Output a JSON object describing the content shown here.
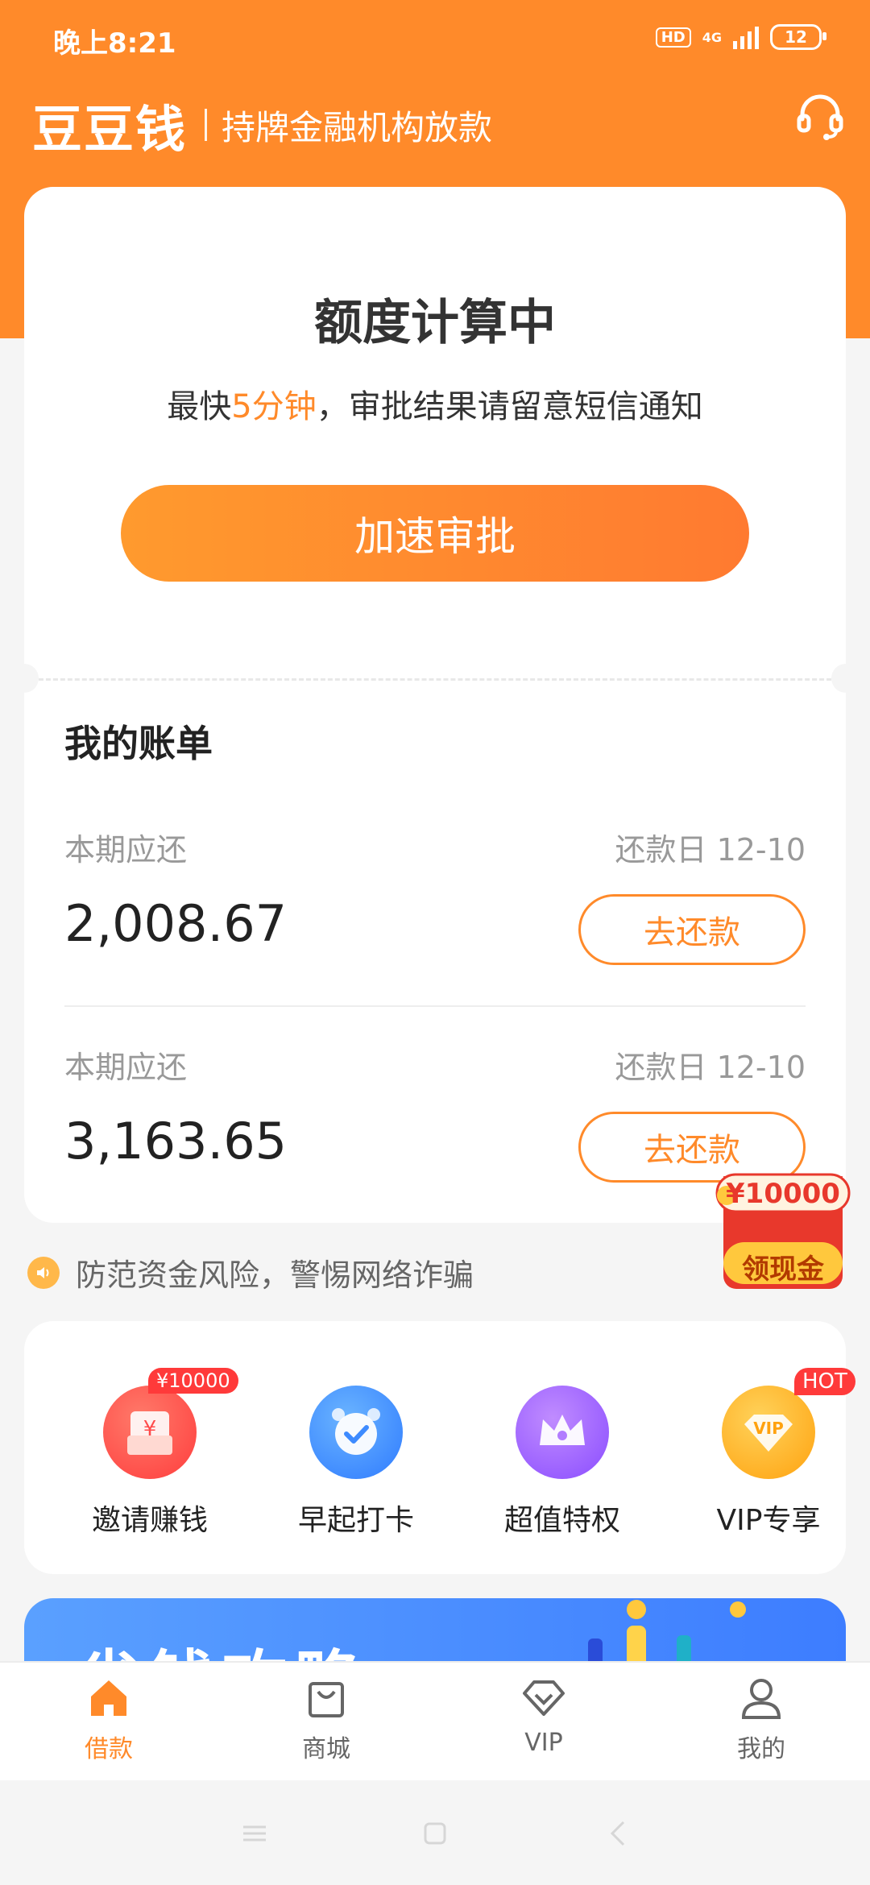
{
  "status": {
    "time": "晚上8:21",
    "hd": "HD",
    "network": "4G",
    "battery": "12"
  },
  "header": {
    "logo": "豆豆钱",
    "slogan": "持牌金融机构放款"
  },
  "quota": {
    "title": "额度计算中",
    "subtitle_prefix": "最快",
    "subtitle_highlight": "5分钟",
    "subtitle_suffix": "，审批结果请留意短信通知",
    "button": "加速审批"
  },
  "bills": {
    "title": "我的账单",
    "items": [
      {
        "label": "本期应还",
        "due": "还款日 12-10",
        "amount": "2,008.67",
        "action": "去还款"
      },
      {
        "label": "本期应还",
        "due": "还款日 12-10",
        "amount": "3,163.65",
        "action": "去还款"
      }
    ]
  },
  "promo": {
    "amount": "¥10000",
    "label": "领现金"
  },
  "notice": "防范资金风险，警惕网络诈骗",
  "quick_actions": [
    {
      "label": "邀请赚钱",
      "badge": "¥10000",
      "icon": "red-envelope-icon",
      "color": "#ff4a4a"
    },
    {
      "label": "早起打卡",
      "badge": "",
      "icon": "alarm-clock-icon",
      "color": "#3d8bff"
    },
    {
      "label": "超值特权",
      "badge": "",
      "icon": "crown-icon",
      "color": "#9a5cff"
    },
    {
      "label": "VIP专享",
      "badge": "HOT",
      "icon": "vip-icon",
      "color": "#ffb020"
    }
  ],
  "banner": {
    "title": "省钱攻略"
  },
  "tabs": [
    {
      "label": "借款",
      "icon": "home-icon",
      "active": true
    },
    {
      "label": "商城",
      "icon": "shopping-bag-icon",
      "active": false
    },
    {
      "label": "VIP",
      "icon": "diamond-icon",
      "active": false
    },
    {
      "label": "我的",
      "icon": "person-icon",
      "active": false
    }
  ],
  "colors": {
    "accent": "#ff8a2a",
    "background": "#f5f5f5"
  }
}
